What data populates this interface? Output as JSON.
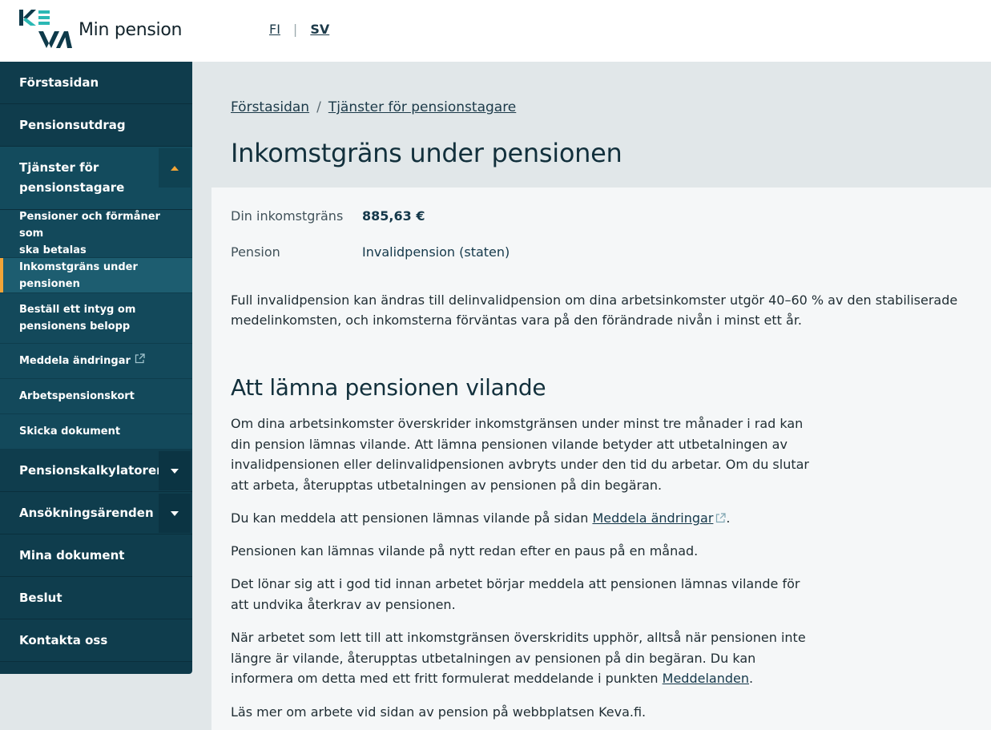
{
  "brand": {
    "logo_text": "KEVA",
    "app_title": "Min pension",
    "accent": "#f2a437",
    "logo_teal": "#2bb8b4",
    "logo_dark": "#0e3a4a"
  },
  "lang": {
    "fi": "FI",
    "sep": "|",
    "sv": "SV"
  },
  "sidebar": {
    "items": [
      {
        "label": "Förstasidan"
      },
      {
        "label": "Pensionsutdrag"
      },
      {
        "label": "Tjänster för pensionstagare",
        "line1": "Tjänster för",
        "line2": "pensionstagare",
        "icon": "caret-up-icon"
      },
      {
        "label": "Pensionskalkylatorer",
        "icon": "caret-down-icon"
      },
      {
        "label": "Ansökningsärenden",
        "icon": "caret-down-icon"
      },
      {
        "label": "Mina dokument"
      },
      {
        "label": "Beslut"
      },
      {
        "label": "Kontakta oss"
      }
    ],
    "sub_items": [
      {
        "line1": "Pensioner och förmåner som",
        "line2": "ska betalas"
      },
      {
        "line1": "Inkomstgräns under pensionen",
        "active": true
      },
      {
        "line1": "Beställ ett intyg om",
        "line2": "pensionens belopp"
      },
      {
        "line1": "Meddela ändringar",
        "icon": "external-link-icon"
      },
      {
        "line1": "Arbetspensionskort"
      },
      {
        "line1": "Skicka dokument"
      }
    ]
  },
  "breadcrumb": {
    "home": "Förstasidan",
    "sep": "/",
    "current": "Tjänster för pensionstagare"
  },
  "page_title": "Inkomstgräns under pensionen",
  "info": {
    "limit_label": "Din inkomstgräns",
    "limit_value": "885,63 €",
    "pension_label": "Pension",
    "pension_value": "Invalidpension (staten)"
  },
  "intro": "Full invalidpension kan ändras till delinvalidpension om dina arbetsinkomster utgör 40–60 % av den stabiliserade medelinkomsten, och inkomsterna förväntas vara på den förändrade nivån i minst ett år.",
  "section": {
    "title": "Att lämna pensionen vilande",
    "p1": "Om dina arbetsinkomster överskrider inkomstgränsen under minst tre månader i rad kan din pension lämnas vilande. Att lämna pensionen vilande betyder att utbetalningen av invalidpensionen eller delinvalidpensionen avbryts under den tid du arbetar. Om du slutar att arbeta, återupptas utbetalningen av pensionen på din begäran.",
    "p2_pre": "Du kan meddela att pensionen lämnas vilande på sidan ",
    "p2_link": "Meddela ändringar",
    "p2_post": ".",
    "p3": "Pensionen kan lämnas vilande på nytt redan efter en paus på en månad.",
    "p4": "Det lönar sig att i god tid innan arbetet börjar meddela att pensionen lämnas vilande för att undvika återkrav av pensionen.",
    "p5_pre": "När arbetet som lett till att inkomstgränsen överskridits upphör, alltså när pensionen inte längre är vilande, återupptas utbetalningen av pensionen på din begäran. Du kan informera om detta med ett fritt formulerat meddelande i punkten ",
    "p5_link": "Meddelanden",
    "p5_post": ".",
    "p6": "Läs mer om arbete vid sidan av pension på webbplatsen Keva.fi."
  }
}
